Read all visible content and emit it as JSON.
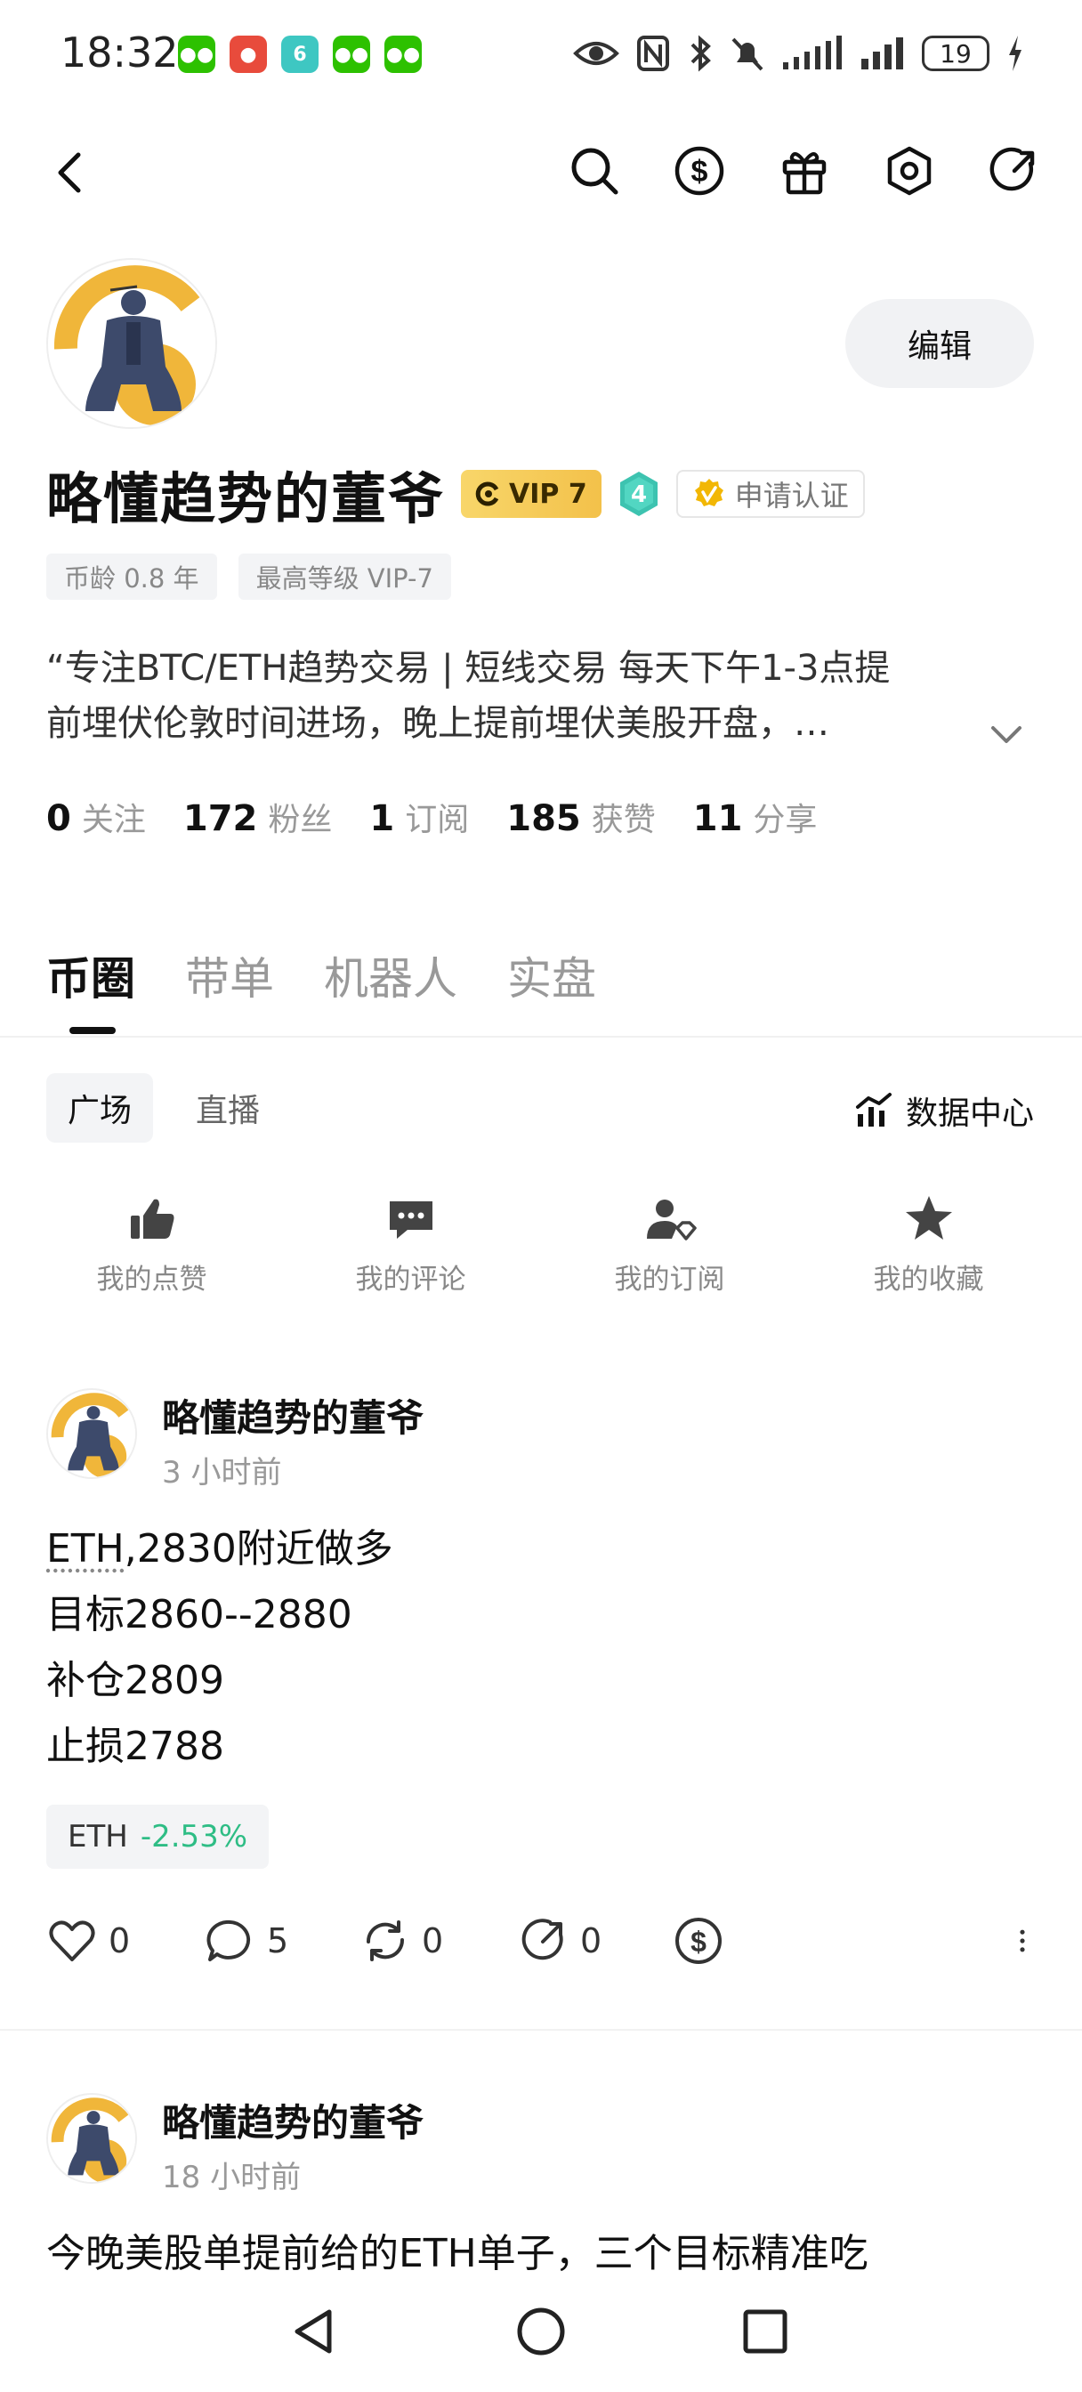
{
  "status_bar": {
    "time": "18:32",
    "battery": "19",
    "apps": [
      "wechat-icon",
      "app-icon",
      "feather-icon",
      "wechat-icon",
      "wechat-icon"
    ]
  },
  "profile": {
    "name": "略懂趋势的董爷",
    "vip": "VIP 7",
    "level": "4",
    "verify": "申请认证",
    "edit": "编辑",
    "tags": [
      "币龄 0.8 年",
      "最高等级 VIP-7"
    ],
    "bio_line1": "“专注BTC/ETH趋势交易 | 短线交易 每天下午1-3点提",
    "bio_line2": "前埋伏伦敦时间进场，晚上提前埋伏美股开盘，…",
    "stats": [
      {
        "num": "0",
        "label": "关注"
      },
      {
        "num": "172",
        "label": "粉丝"
      },
      {
        "num": "1",
        "label": "订阅"
      },
      {
        "num": "185",
        "label": "获赞"
      },
      {
        "num": "11",
        "label": "分享"
      }
    ]
  },
  "main_tabs": [
    "币圈",
    "带单",
    "机器人",
    "实盘"
  ],
  "sub_tabs": [
    "广场",
    "直播"
  ],
  "data_center": "数据中心",
  "quick_actions": [
    "我的点赞",
    "我的评论",
    "我的订阅",
    "我的收藏"
  ],
  "posts": [
    {
      "author": "略懂趋势的董爷",
      "time": "3 小时前",
      "line1_coin": "ETH",
      "line1_rest": ",2830附近做多",
      "line2": "目标2860--2880",
      "line3": "补仓2809",
      "line4": "止损2788",
      "chip_coin": "ETH",
      "chip_change": "-2.53%",
      "likes": "0",
      "comments": "5",
      "reposts": "0",
      "shares": "0"
    },
    {
      "author": "略懂趋势的董爷",
      "time": "18 小时前",
      "line1": "今晚美股单提前给的ETH单子，三个目标精准吃"
    }
  ],
  "colors": {
    "accent_green": "#2ebd85",
    "vip_gold": "#f3c14a",
    "avatar_bg": "#f0b63a"
  }
}
